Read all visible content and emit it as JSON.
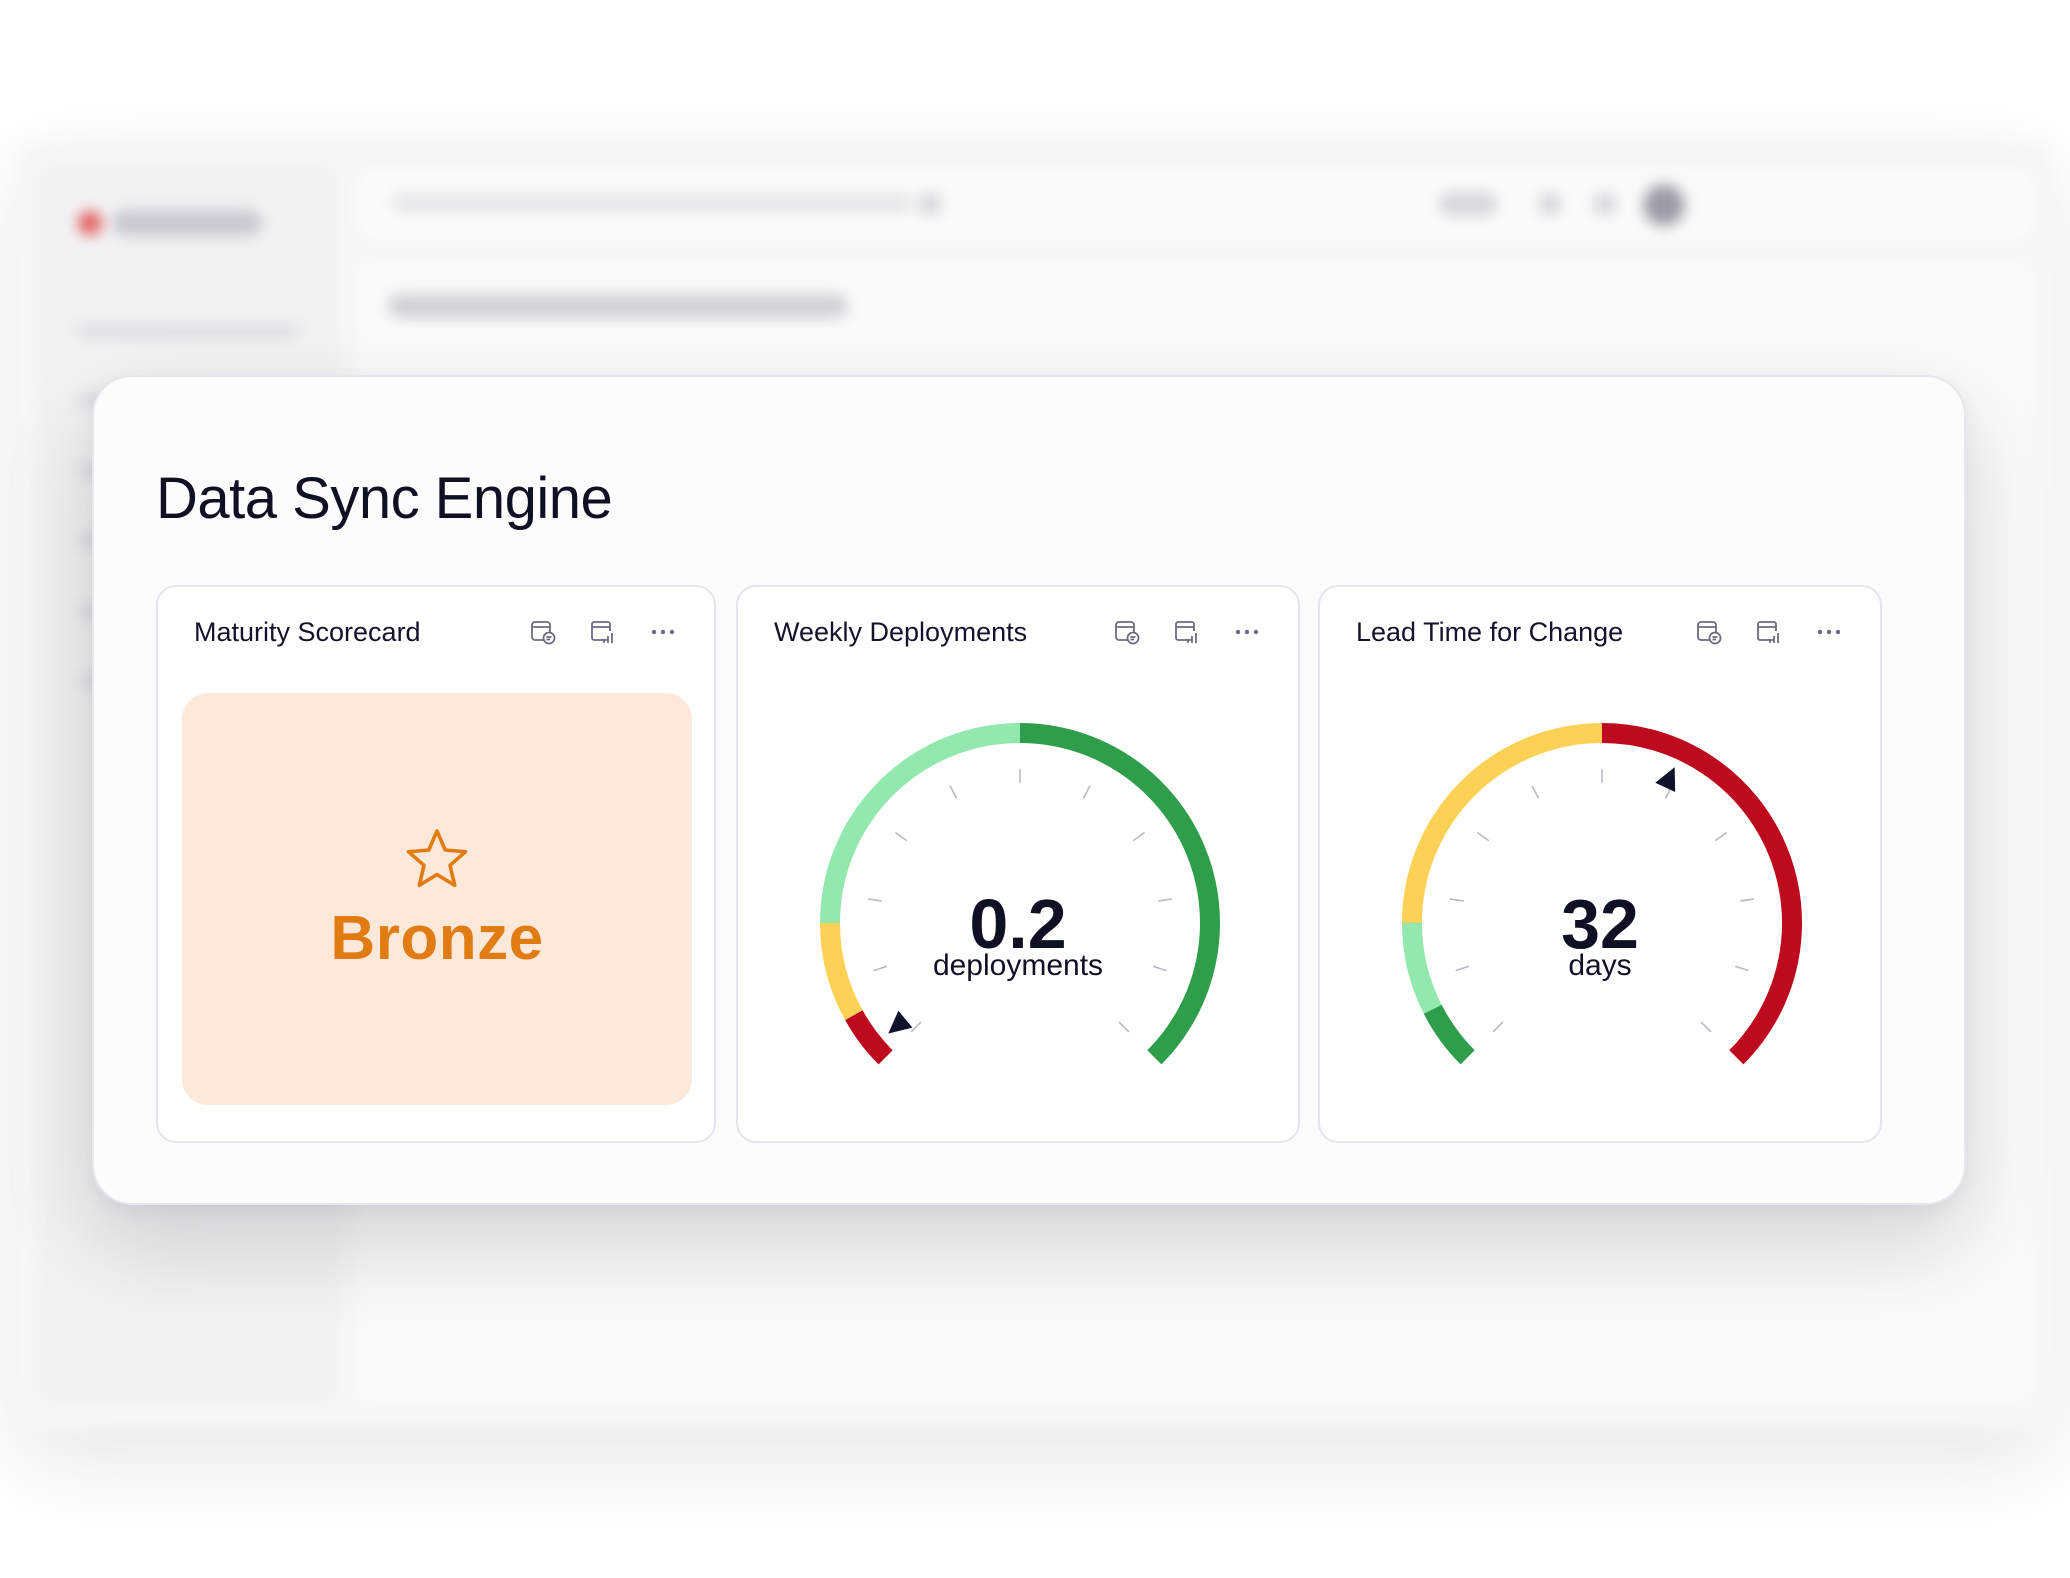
{
  "colors": {
    "dark_green": "#2f9e4a",
    "light_green": "#92e8ae",
    "yellow": "#fcd155",
    "red": "#bd0a1e",
    "bronze": "#e07c12",
    "bronze_bg": "#fde8da",
    "needle": "#11122b"
  },
  "page": {
    "title": "Data Sync Engine"
  },
  "widgets": {
    "scorecard": {
      "title": "Maturity Scorecard",
      "level": "Bronze",
      "icon": "star-outline-icon"
    },
    "deployments": {
      "title": "Weekly Deployments",
      "value": "0.2",
      "unit": "deployments",
      "needle_angle": 230,
      "segments": [
        {
          "from": 225,
          "to": 241,
          "color": "red"
        },
        {
          "from": 241,
          "to": 270,
          "color": "yellow"
        },
        {
          "from": 270,
          "to": 360,
          "color": "light_green"
        },
        {
          "from": 0,
          "to": 135,
          "color": "dark_green"
        }
      ]
    },
    "lead_time": {
      "title": "Lead Time for Change",
      "value": "32",
      "unit": "days",
      "needle_angle": 25,
      "segments": [
        {
          "from": 225,
          "to": 243,
          "color": "dark_green"
        },
        {
          "from": 243,
          "to": 270,
          "color": "light_green"
        },
        {
          "from": 270,
          "to": 360,
          "color": "yellow"
        },
        {
          "from": 0,
          "to": 135,
          "color": "red"
        }
      ]
    }
  },
  "icons": {
    "comment": "comment-icon",
    "chart": "chart-icon",
    "more": "more-icon"
  }
}
